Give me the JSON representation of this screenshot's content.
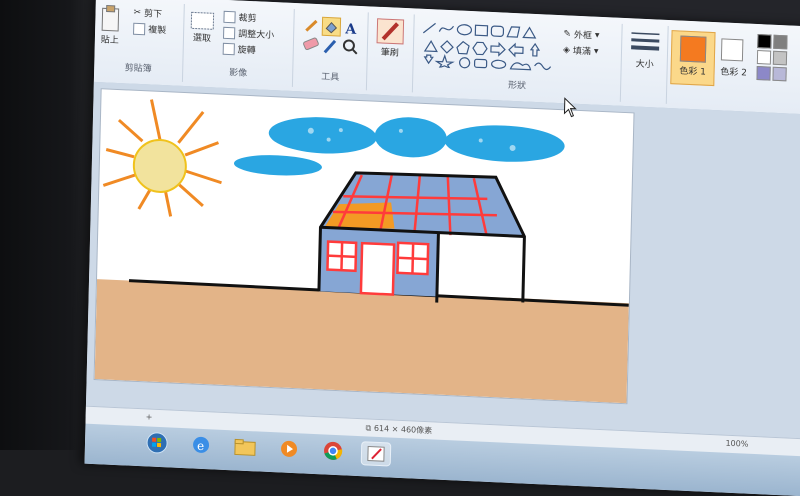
{
  "app": {
    "name": "Paint"
  },
  "ribbon": {
    "clipboard": {
      "paste_label": "貼上",
      "cut_label": "剪下",
      "copy_label": "複製",
      "group_label": "剪貼簿"
    },
    "image": {
      "select_label": "選取",
      "crop_label": "裁剪",
      "resize_label": "調整大小",
      "rotate_label": "旋轉",
      "group_label": "影像"
    },
    "tools": {
      "text_tool": "A",
      "group_label": "工具"
    },
    "brushes": {
      "label": "筆刷"
    },
    "shapes": {
      "outline_label": "外框",
      "fill_label": "填滿",
      "group_label": "形狀"
    },
    "size": {
      "label": "大小"
    },
    "colors": {
      "color1_label": "色彩 1",
      "color2_label": "色彩 2",
      "color1": "#f47a20",
      "color2": "#ffffff",
      "palette": [
        "#000000",
        "#7f7f7f",
        "#ffffff",
        "#c3c3c3",
        "#8c88c8",
        "#b8b8d8"
      ]
    }
  },
  "canvas": {
    "background": "#ffffff",
    "ground_color": "#e3b488",
    "sun_color": "#f2e39d",
    "sun_outline": "#f0c21c",
    "ray_color": "#f08a24",
    "cloud_color": "#2aa6e2",
    "wall_color": "#86a6d4",
    "roof_color": "#86a6d4",
    "roof_patch_color": "#f39a24",
    "grid_color": "#ff3b3b",
    "outline_color": "#111111"
  },
  "statusbar": {
    "dimensions": "614 × 460像素",
    "zoom": "100%"
  },
  "taskbar": {
    "items": [
      "start-orb",
      "internet-explorer",
      "file-explorer",
      "media-player",
      "chrome",
      "paint"
    ]
  }
}
